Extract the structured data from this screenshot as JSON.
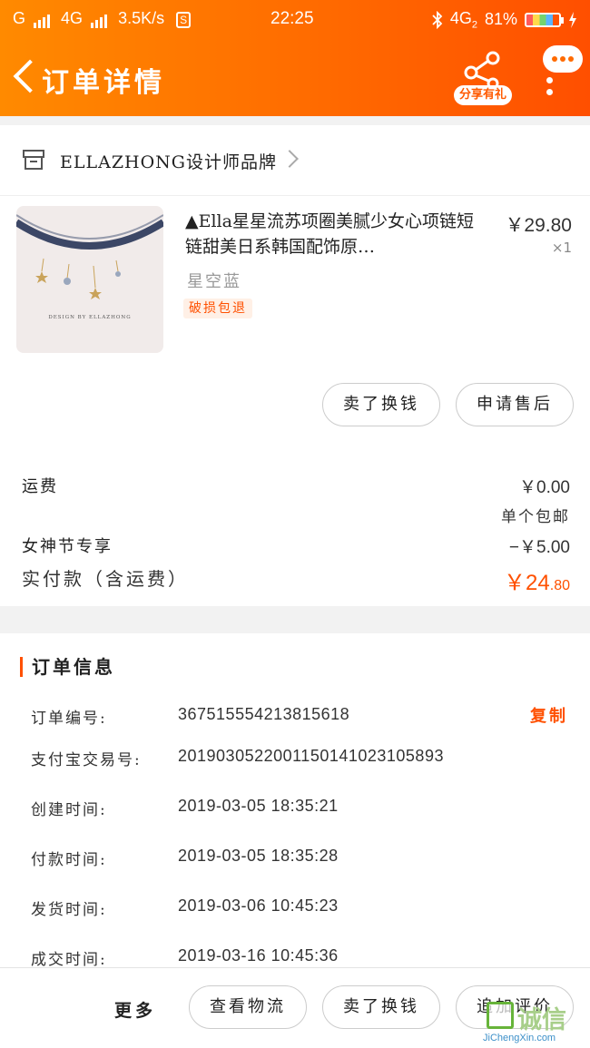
{
  "status_bar": {
    "signal1": "G",
    "signal2": "4G",
    "speed": "3.5K/s",
    "sim_badge": "S",
    "time": "22:25",
    "network": "4G",
    "network_sub": "2",
    "battery": "81%"
  },
  "header": {
    "title": "订单详情",
    "share_label": "分享有礼"
  },
  "store": {
    "name": "ELLAZHONG设计师品牌"
  },
  "product": {
    "title": "▲Ella星星流苏项圈美腻少女心项链短链甜美日系韩国配饰原…",
    "price": "￥29.80",
    "quantity": "×1",
    "sku": "星空蓝",
    "tag": "破损包退",
    "brand_mark": "DESIGN BY ELLAZHONG"
  },
  "item_actions": {
    "resell": "卖了换钱",
    "after_sale": "申请售后"
  },
  "fees": {
    "shipping_label": "运费",
    "shipping_value": "￥0.00",
    "shipping_note": "单个包邮",
    "promo_label": "女神节专享",
    "promo_value": "−￥5.00",
    "total_label": "实付款（含运费）",
    "total_currency": "￥",
    "total_int": "24",
    "total_dec": ".80"
  },
  "order_info": {
    "title": "订单信息",
    "copy_label": "复制",
    "rows": [
      {
        "label": "订单编号:",
        "value": "367515554213815618"
      },
      {
        "label": "支付宝交易号:",
        "value": "2019030522001150141023105893"
      },
      {
        "label": "创建时间:",
        "value": "2019-03-05 18:35:21"
      },
      {
        "label": "付款时间:",
        "value": "2019-03-05 18:35:28"
      },
      {
        "label": "发货时间:",
        "value": "2019-03-06 10:45:23"
      },
      {
        "label": "成交时间:",
        "value": "2019-03-16 10:45:36"
      }
    ]
  },
  "bottom_bar": {
    "more": "更多",
    "logistics": "查看物流",
    "resell": "卖了换钱",
    "review": "追加评价"
  },
  "watermark": {
    "text": "诚信",
    "url": "JiChengXin.com"
  },
  "colors": {
    "accent": "#ff5000",
    "header_start": "#ff8a00",
    "header_end": "#ff4f00"
  }
}
